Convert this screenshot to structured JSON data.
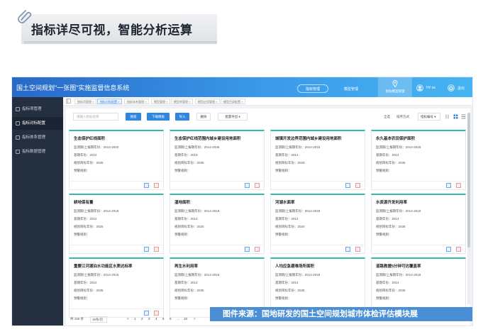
{
  "banner": {
    "title": "指标详尽可视，智能分析运算"
  },
  "app": {
    "title": "国土空间规划\"一张图\"实施监督信息系统",
    "top_buttons": [
      "指标管理",
      "模型管理"
    ],
    "active_nav": "指标模型管理",
    "user": "Hi! sa",
    "exit": "退出"
  },
  "sidebar": {
    "items": [
      {
        "label": "指标项管理"
      },
      {
        "label": "指标对标配置"
      },
      {
        "label": "指标体系管理"
      },
      {
        "label": "指标数据管理"
      }
    ]
  },
  "breadcrumb": {
    "tabs": [
      "指标项管理 ×",
      "指标对标配置 ×",
      "指标体系管理 ×",
      "模型管理 ×",
      "模型库管理 ×",
      "模型应用管理 ×",
      "模型目录配置 ×"
    ]
  },
  "toolbar": {
    "search_placeholder": "请输入指标名称",
    "search_btn": "搜索",
    "download_btn": "下载模板",
    "import_btn": "导入",
    "delete_btn": "删除",
    "batch_export": "批量导出 ▾",
    "select_all": "全选",
    "sort_label": "排序方式",
    "sort_value": "指标编号 ▾"
  },
  "card_labels": {
    "period": "监测期/上报期年份：",
    "base": "基期年份：",
    "target": "规划目标年份：",
    "warn": "预警规则："
  },
  "cards": [
    {
      "title": "生态保护红线面积",
      "period": "2014-2020",
      "base": "2014",
      "target": "2035"
    },
    {
      "title": "生态保护红线范围内城乡建设用地面积",
      "period": "2014-2035",
      "base": "2019",
      "target": "2035"
    },
    {
      "title": "城镇开发边界范围内城乡建设用地面积",
      "period": "2014-2018",
      "base": "2014",
      "target": "2025"
    },
    {
      "title": "永久基本农田保护面积",
      "period": "2014-2018",
      "base": "2014",
      "target": "2035"
    },
    {
      "title": "耕地保有量",
      "period": "2014-2018",
      "base": "2014",
      "target": "2025"
    },
    {
      "title": "湿地面积",
      "period": "2014-2018",
      "base": "2014",
      "target": "2025"
    },
    {
      "title": "河湖水面率",
      "period": "2014-2018",
      "base": "2014",
      "target": "2020"
    },
    {
      "title": "水资源开发利用率",
      "period": "2014-2018",
      "base": "2014",
      "target": "2035"
    },
    {
      "title": "重要江河湖泊水功能区水质达标率",
      "period": "2014-2018",
      "base": "2014",
      "target": "2035"
    },
    {
      "title": "再生水利用率",
      "period": "2014-2018",
      "base": "2014",
      "target": "2035"
    },
    {
      "title": "人均应急避难场所面积",
      "period": "2014-2018",
      "base": "2014",
      "target": "2035"
    },
    {
      "title": "道路救援5分钟可达覆盖率",
      "period": "2014-2018",
      "base": "2014",
      "target": "2035"
    }
  ],
  "pager": {
    "total": "共 156 条",
    "page_size": "16条/页",
    "pages": [
      "<",
      "1",
      "2",
      "3",
      "4",
      "5",
      "6",
      "…",
      "10",
      ">"
    ]
  },
  "source": "图件来源：国地研发的国土空间规划城市体检评估模块展"
}
